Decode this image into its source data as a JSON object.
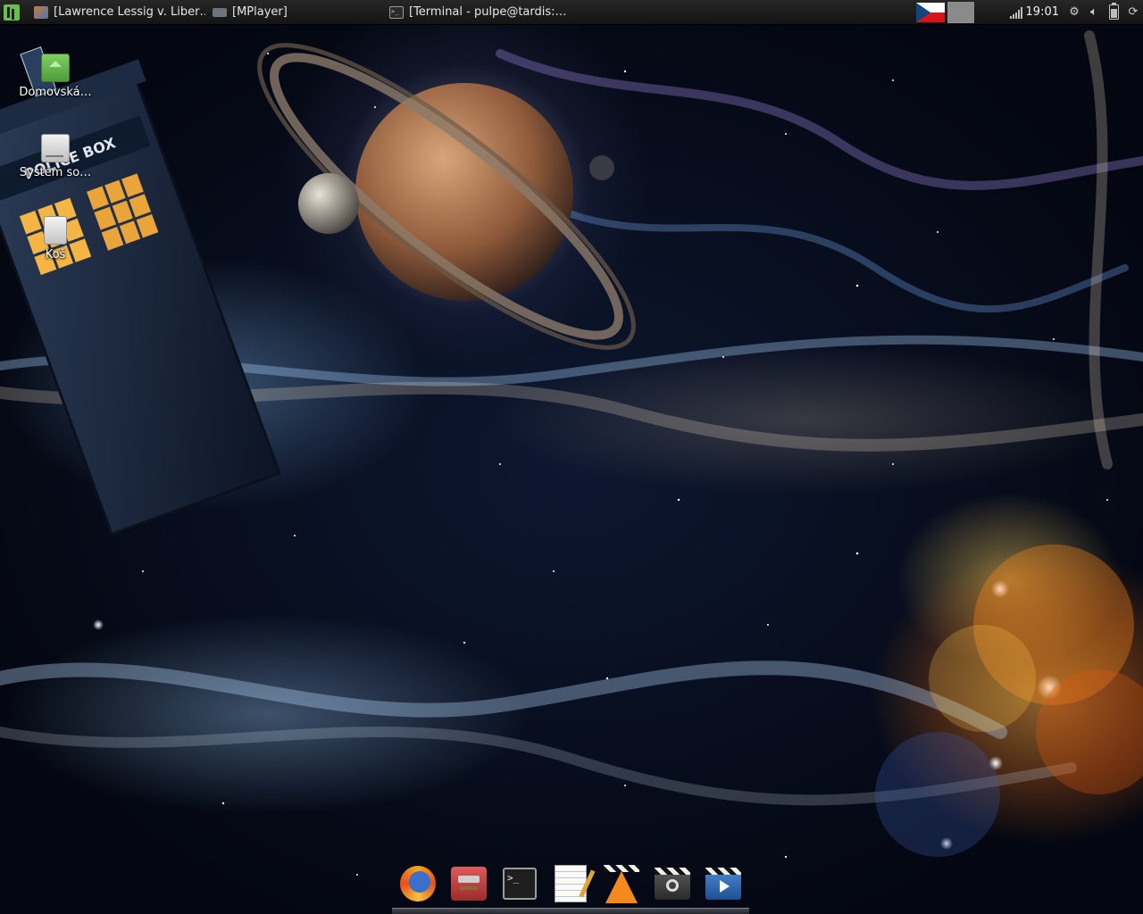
{
  "top_panel": {
    "tasks": [
      {
        "label": "[Lawrence Lessig v. Liber…",
        "icon": "browser-icon"
      },
      {
        "label": "[MPlayer]",
        "icon": "window-icon"
      },
      {
        "label": "[Terminal - pulpe@tardis:…",
        "icon": "terminal-icon"
      }
    ],
    "keyboard_layout_icon": "czech-flag",
    "clock": "19:01",
    "tray_icons": [
      "signal-icon",
      "settings-gear-icon",
      "volume-icon",
      "battery-icon",
      "power-icon"
    ]
  },
  "desktop_icons": [
    {
      "label": "Domovská…",
      "icon": "home-folder-icon"
    },
    {
      "label": "Systém so…",
      "icon": "drive-icon"
    },
    {
      "label": "Koš",
      "icon": "trash-icon"
    }
  ],
  "dock": {
    "items": [
      {
        "icon": "firefox-icon"
      },
      {
        "icon": "tools-icon"
      },
      {
        "icon": "terminal-icon",
        "glyph": ">_"
      },
      {
        "icon": "text-editor-icon"
      },
      {
        "icon": "vlc-icon"
      },
      {
        "icon": "steam-icon"
      },
      {
        "icon": "video-player-icon"
      }
    ]
  },
  "colors": {
    "panel_bg": "#1c1c1c",
    "menu_green": "#6abf4b",
    "space_bg": "#050813",
    "nebula_orange": "#ff9a2e"
  }
}
